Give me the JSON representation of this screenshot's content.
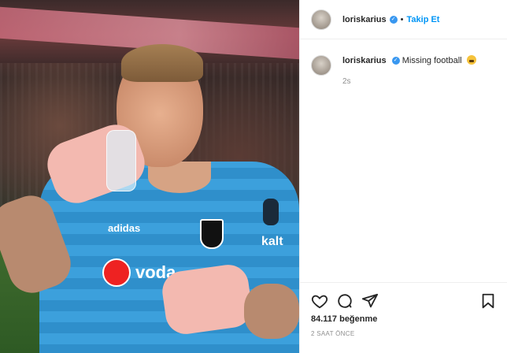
{
  "post": {
    "username": "loriskarius",
    "follow_label": "Takip Et",
    "separator": "•",
    "caption_text": "Missing football",
    "caption_time": "2s",
    "likes": "84.117 beğenme",
    "posted_ago": "2 SAAT ÖNCE"
  },
  "photo": {
    "sponsor_text": "voda",
    "brand_text": "adidas",
    "chest_text": "kalt"
  },
  "icons": {
    "like": "heart-icon",
    "comment": "comment-icon",
    "share": "share-icon",
    "save": "bookmark-icon",
    "verified": "verified-badge-icon"
  },
  "colors": {
    "follow": "#0095f6",
    "verified": "#3897f0",
    "shirt": "#3ca0dc"
  }
}
